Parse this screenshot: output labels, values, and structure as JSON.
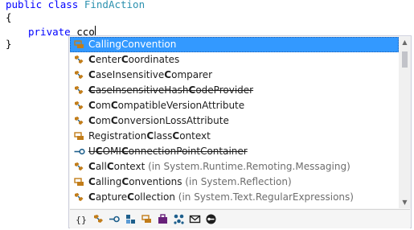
{
  "editor": {
    "line1_keyword": "public class",
    "line1_class": "FindAction",
    "line2": "{",
    "line3_keyword": "private",
    "line3_typed": "cco",
    "line4": "}"
  },
  "completion": {
    "items": [
      {
        "pre": "",
        "match": "C",
        "post": "alling",
        "match2": "C",
        "post2": "onvention",
        "ns": "",
        "icon": "enum",
        "strike": false,
        "selected": true
      },
      {
        "pre": "",
        "match": "C",
        "post": "enter",
        "match2": "C",
        "post2": "oordinates",
        "ns": "",
        "icon": "class",
        "strike": false,
        "selected": false
      },
      {
        "pre": "",
        "match": "C",
        "post": "aseInsensitive",
        "match2": "C",
        "post2": "omparer",
        "ns": "",
        "icon": "class",
        "strike": false,
        "selected": false
      },
      {
        "pre": "",
        "match": "C",
        "post": "aseInsensitiveHash",
        "match2": "C",
        "post2": "odeProvider",
        "ns": "",
        "icon": "class",
        "strike": true,
        "selected": false
      },
      {
        "pre": "",
        "match": "C",
        "post": "om",
        "match2": "C",
        "post2": "ompatibleVersionAttribute",
        "ns": "",
        "icon": "class",
        "strike": false,
        "selected": false
      },
      {
        "pre": "",
        "match": "C",
        "post": "om",
        "match2": "C",
        "post2": "onversionLossAttribute",
        "ns": "",
        "icon": "class",
        "strike": false,
        "selected": false
      },
      {
        "pre": "Registration",
        "match": "C",
        "post": "lass",
        "match2": "C",
        "post2": "ontext",
        "ns": "",
        "icon": "enum",
        "strike": false,
        "selected": false
      },
      {
        "pre": "U",
        "match": "C",
        "post": "OMI",
        "match2": "C",
        "post2": "onnectionPointContainer",
        "ns": "",
        "icon": "interface",
        "strike": true,
        "selected": false
      },
      {
        "pre": "",
        "match": "C",
        "post": "all",
        "match2": "C",
        "post2": "ontext",
        "ns": "(in System.Runtime.Remoting.Messaging)",
        "icon": "class",
        "strike": false,
        "selected": false
      },
      {
        "pre": "",
        "match": "C",
        "post": "alling",
        "match2": "C",
        "post2": "onventions",
        "ns": "(in System.Reflection)",
        "icon": "enum",
        "strike": false,
        "selected": false
      },
      {
        "pre": "",
        "match": "C",
        "post": "apture",
        "match2": "C",
        "post2": "ollection",
        "ns": "(in System.Text.RegularExpressions)",
        "icon": "class",
        "strike": false,
        "selected": false
      }
    ],
    "filters": [
      "namespace-filter-icon",
      "class-filter-icon",
      "interface-filter-icon",
      "structure-filter-icon",
      "enum-filter-icon",
      "module-filter-icon",
      "delegate-filter-icon",
      "envelope-filter-icon",
      "key-filter-icon"
    ],
    "colors": {
      "accent": "#3399ff",
      "class_icon": "#c27d1a",
      "enum_icon": "#c27d1a",
      "interface_icon": "#1e5f8c"
    }
  }
}
